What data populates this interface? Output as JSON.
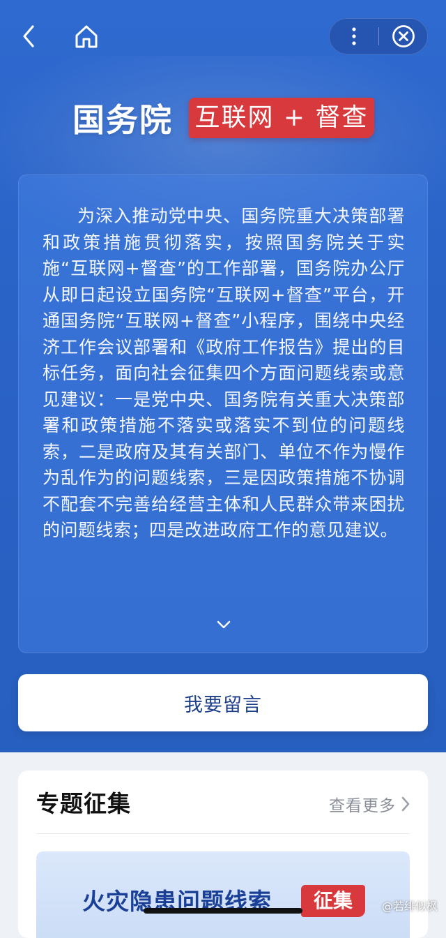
{
  "nav": {
    "back_icon": "chevron-left-icon",
    "home_icon": "home-icon",
    "more_icon": "more-vertical-icon",
    "close_icon": "close-circle-icon"
  },
  "header": {
    "title": "国务院",
    "badge": "互联网 + 督查"
  },
  "intro": {
    "text": "为深入推动党中央、国务院重大决策部署和政策措施贯彻落实，按照国务院关于实施“互联网+督查”的工作部署，国务院办公厅从即日起设立国务院“互联网+督查”平台，开通国务院“互联网+督查”小程序，围绕中央经济工作会议部署和《政府工作报告》提出的目标任务，面向社会征集四个方面问题线索或意见建议：一是党中央、国务院有关重大决策部署和政策措施不落实或落实不到位的问题线索，二是政府及其有关部门、单位不作为慢作为乱作为的问题线索，三是因政策措施不协调不配套不完善给经营主体和人民群众带来困扰的问题线索；四是改进政府工作的意见建议。",
    "expand_icon": "chevron-down-icon"
  },
  "actions": {
    "message_label": "我要留言"
  },
  "topics": {
    "heading": "专题征集",
    "more_label": "查看更多",
    "banner_title": "火灾隐患问题线索",
    "banner_badge": "征集"
  },
  "watermark": "@若绯似枫",
  "colors": {
    "primary_blue": "#2a63c6",
    "accent_red": "#d7393c",
    "button_text": "#1d3f8a"
  }
}
